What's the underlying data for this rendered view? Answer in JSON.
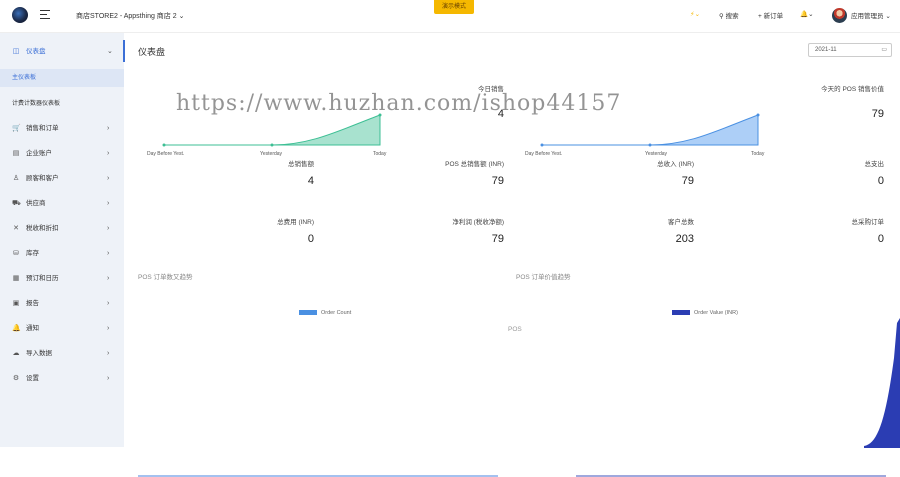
{
  "topbar": {
    "store_name": "商店STORE2 - Appsthing 商店 2",
    "demo_badge": "演示模式",
    "search": "搜索",
    "new_order": "新订单",
    "user_name": "应用管理员"
  },
  "sidebar": {
    "items": [
      {
        "label": "仪表盘",
        "icon": "dashboard-icon"
      },
      {
        "label": "销售和订单",
        "icon": "cart-icon"
      },
      {
        "label": "企业账户",
        "icon": "account-icon"
      },
      {
        "label": "顾客和客户",
        "icon": "user-icon"
      },
      {
        "label": "供应商",
        "icon": "truck-icon"
      },
      {
        "label": "税收和折扣",
        "icon": "percent-icon"
      },
      {
        "label": "库存",
        "icon": "inventory-icon"
      },
      {
        "label": "预订和日历",
        "icon": "calendar-icon"
      },
      {
        "label": "报告",
        "icon": "report-icon"
      },
      {
        "label": "通知",
        "icon": "bell-icon"
      },
      {
        "label": "导入数据",
        "icon": "cloud-upload-icon"
      },
      {
        "label": "设置",
        "icon": "gear-icon"
      }
    ],
    "sub_items": [
      "主仪表板",
      "计费计数器仪表板"
    ]
  },
  "main": {
    "title": "仪表盘",
    "date": "2021-11",
    "watermark": "https://www.huzhan.com/ishop44157",
    "sparklines": {
      "left": {
        "labels": [
          "Day Before Yest.",
          "Yesterday",
          "Today"
        ],
        "values": [
          0,
          0,
          4
        ],
        "color": "#3dbf94"
      },
      "right": {
        "labels": [
          "Day Before Yest.",
          "Yesterday",
          "Today"
        ],
        "values": [
          0,
          0,
          79
        ],
        "color": "#6aa8f0"
      }
    },
    "kpis_top": [
      {
        "label": "今日销售",
        "value": "4"
      },
      {
        "label": "今天的 POS 销售价值",
        "value": "79"
      }
    ],
    "kpis_row1": [
      {
        "label": "总销售额",
        "value": "4"
      },
      {
        "label": "POS 总销售额 (INR)",
        "value": "79"
      },
      {
        "label": "总收入 (INR)",
        "value": "79"
      },
      {
        "label": "总支出",
        "value": "0"
      }
    ],
    "kpis_row2": [
      {
        "label": "总费用 (INR)",
        "value": "0"
      },
      {
        "label": "净利润 (税收净额)",
        "value": "79"
      },
      {
        "label": "客户总数",
        "value": "203"
      },
      {
        "label": "总采购订单",
        "value": "0"
      }
    ],
    "charts": {
      "order_count_title": "POS 订单数又趋势",
      "order_value_title": "POS 订单价值趋势",
      "legend_count": "Order Count",
      "legend_value": "Order Value (INR)",
      "pos_label": "POS",
      "count_color": "#4a90e2",
      "value_color": "#2b3db3"
    }
  }
}
